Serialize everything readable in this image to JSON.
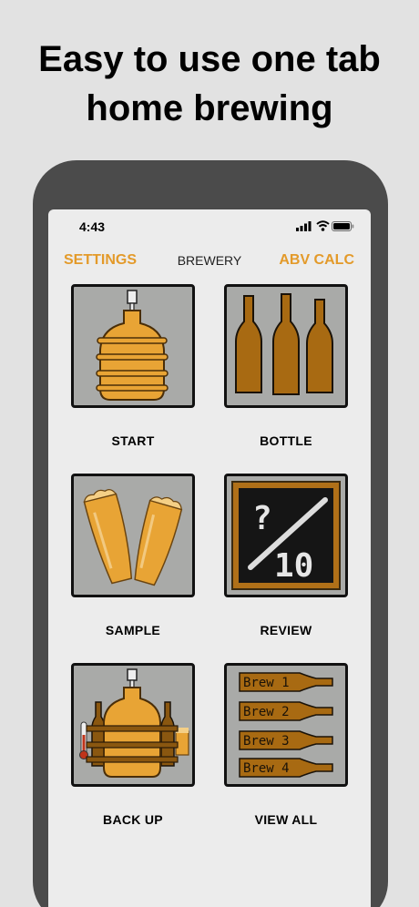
{
  "headline": {
    "line1": "Easy to use one tab",
    "line2": "home brewing"
  },
  "status_bar": {
    "time": "4:43",
    "icons": [
      "signal-icon",
      "wifi-icon",
      "battery-icon"
    ]
  },
  "nav": {
    "left": "SETTINGS",
    "title": "BREWERY",
    "right": "ABV CALC"
  },
  "colors": {
    "accent": "#e39a2a",
    "tile_bg": "#a9aaa8",
    "amber": "#e8a435",
    "bottle_brown": "#a86a12",
    "chalkboard": "#151515"
  },
  "tiles": [
    {
      "label": "START",
      "icon": "carboy-icon"
    },
    {
      "label": "BOTTLE",
      "icon": "bottles-icon"
    },
    {
      "label": "SAMPLE",
      "icon": "beer-glasses-icon"
    },
    {
      "label": "REVIEW",
      "icon": "chalkboard-rating-icon",
      "chalk_top": "?",
      "chalk_bottom": "10"
    },
    {
      "label": "BACK UP",
      "icon": "brewery-setup-icon"
    },
    {
      "label": "VIEW ALL",
      "icon": "bottle-list-icon",
      "bottle_labels": [
        "Brew 1",
        "Brew 2",
        "Brew 3",
        "Brew 4"
      ]
    }
  ]
}
